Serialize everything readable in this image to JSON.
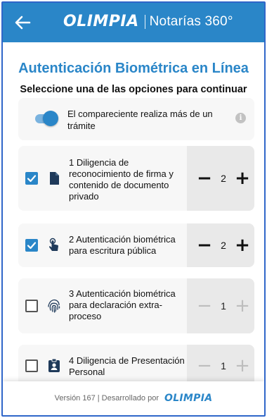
{
  "header": {
    "brand_logo": "OLIMPIA",
    "brand_subtitle": "Notarías 360°"
  },
  "page": {
    "title": "Autenticación Biométrica en Línea",
    "subtitle": "Seleccione una de las opciones para continuar"
  },
  "toggle": {
    "label": "El compareciente realiza más de un trámite",
    "enabled": true
  },
  "options": [
    {
      "label": "1 Diligencia de reconocimiento de firma y contenido de documento privado",
      "checked": true,
      "quantity": "2",
      "icon": "document-icon"
    },
    {
      "label": "2 Autenticación biométrica para escritura pública",
      "checked": true,
      "quantity": "2",
      "icon": "touch-icon"
    },
    {
      "label": "3 Autenticación biométrica para declaración extra-proceso",
      "checked": false,
      "quantity": "1",
      "icon": "fingerprint-icon"
    },
    {
      "label": "4 Diligencia de Presentación Personal",
      "checked": false,
      "quantity": "1",
      "icon": "id-badge-icon"
    }
  ],
  "stepper": {
    "minus": "−",
    "plus": "+"
  },
  "footer": {
    "text": "Versión 167 | Desarrollado por",
    "logo": "OLIMPIA"
  },
  "colors": {
    "primary": "#2a86c8",
    "frame": "#2f66c9"
  }
}
